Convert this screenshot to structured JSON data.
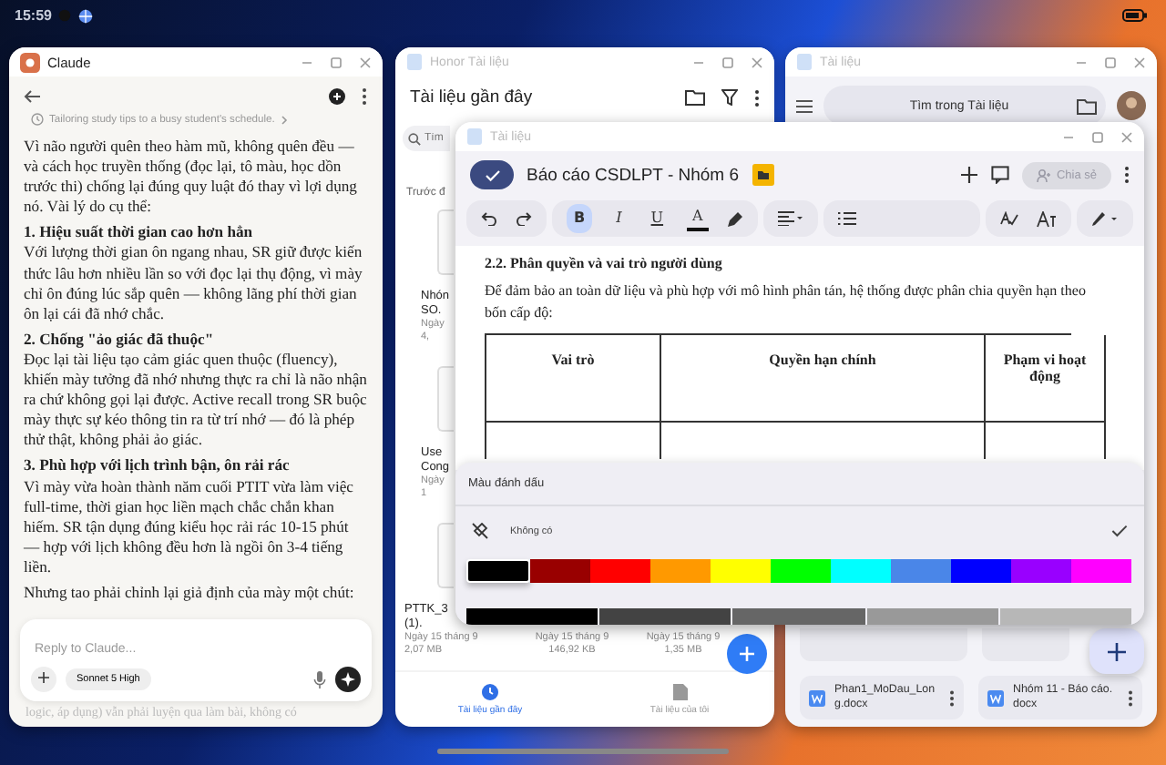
{
  "status_bar": {
    "time": "15:59"
  },
  "claude_window": {
    "title": "Claude",
    "chat_title": "Tailoring study tips to a busy student's schedule.",
    "blocks": [
      {
        "kind": "paragraph",
        "text": "Vì não người quên theo hàm mũ, không quên đều — và cách học truyền thống (đọc lại, tô màu, học dồn trước thi) chống lại đúng quy luật đó thay vì lợi dụng nó. Vài lý do cụ thể:"
      },
      {
        "kind": "heading",
        "text": "1. Hiệu suất thời gian cao hơn hẳn"
      },
      {
        "kind": "paragraph",
        "text": "Với lượng thời gian ôn ngang nhau, SR giữ được kiến thức lâu hơn nhiều lần so với đọc lại thụ động, vì mày chỉ ôn đúng lúc sắp quên — không lãng phí thời gian ôn lại cái đã nhớ chắc."
      },
      {
        "kind": "heading",
        "text": "2. Chống \"ảo giác đã thuộc\""
      },
      {
        "kind": "paragraph",
        "text": "Đọc lại tài liệu tạo cảm giác quen thuộc (fluency), khiến mày tưởng đã nhớ nhưng thực ra chỉ là não nhận ra chứ không gọi lại được. Active recall trong SR buộc mày thực sự kéo thông tin ra từ trí nhớ — đó là phép thử thật, không phải ảo giác."
      },
      {
        "kind": "heading",
        "text": "3. Phù hợp với lịch trình bận, ôn rải rác"
      },
      {
        "kind": "paragraph",
        "text": "Vì mày vừa hoàn thành năm cuối PTIT vừa làm việc full-time, thời gian học liền mạch chắc chắn khan hiếm. SR tận dụng đúng kiểu học rải rác 10-15 phút — hợp với lịch không đều hơn là ngồi ôn 3-4 tiếng liền."
      },
      {
        "kind": "paragraph",
        "text": "Nhưng tao phải chỉnh lại giả định của mày một chút:"
      }
    ],
    "reply": {
      "placeholder": "Reply to Claude...",
      "model": "Sonnet 5 High"
    },
    "tail_line": "logic, áp dụng) vẫn phải luyện qua làm bài, không có"
  },
  "files_window": {
    "title": "Honor Tài liệu",
    "heading": "Tài liệu gần đây",
    "search": {
      "placeholder": "Tìm"
    },
    "section": "Trước đ",
    "partial_files": [
      {
        "name": [
          "Nhón",
          "SO."
        ],
        "date": "Ngày",
        "size": "4,"
      },
      {
        "name": [
          "Use",
          "Cong"
        ],
        "date": "Ngày",
        "size": "1"
      }
    ],
    "bottom_files": [
      {
        "name": [
          "PTTK_3",
          "(1)."
        ],
        "date": "Ngày 15 tháng 9",
        "size": "2,07 MB"
      },
      {
        "date": "Ngày 15 tháng 9",
        "size": "146,92 KB"
      },
      {
        "date": "Ngày 15 tháng 9",
        "size": "1,35 MB"
      }
    ],
    "nav": [
      {
        "label": "Tài liệu gần đây",
        "kind": "recent",
        "selected": true
      },
      {
        "label": "Tài liệu của tôi",
        "kind": "mine",
        "selected": false
      }
    ]
  },
  "docs_window": {
    "title": "Tài liệu",
    "search": {
      "placeholder": "Tìm trong Tài liệu"
    },
    "files": [
      {
        "name": "Phan1_MoDau_Long.docx"
      },
      {
        "name": "Nhóm 11 - Báo cáo.docx"
      }
    ]
  },
  "editor_window": {
    "title": "Tài liệu",
    "doc_title": "Báo cáo CSDLPT - Nhóm 6",
    "share": {
      "label": "Chia sẻ",
      "disabled": true
    },
    "toolbar": [
      [
        {
          "kind": "undo"
        },
        {
          "kind": "redo"
        }
      ],
      [
        {
          "kind": "bold",
          "label": "B",
          "on": true
        },
        {
          "kind": "italic",
          "label": "I",
          "on": false
        },
        {
          "kind": "underline",
          "label": "U",
          "on": false
        },
        {
          "kind": "text_color",
          "label": "A",
          "on": false
        },
        {
          "kind": "highlighter"
        }
      ],
      [
        {
          "kind": "align"
        }
      ],
      [
        {
          "kind": "list"
        }
      ],
      [
        {
          "kind": "spellcheck"
        },
        {
          "kind": "text_format"
        }
      ],
      [
        {
          "kind": "pen"
        }
      ]
    ],
    "heading": "2.2. Phân quyền và vai trò người dùng",
    "paragraph": "Để đảm bảo an toàn dữ liệu và phù hợp với mô hình phân tán, hệ thống được phân chia quyền hạn theo bốn cấp độ:",
    "table": {
      "columns": [
        "Vai trò",
        "Quyền hạn chính",
        "Phạm vi hoạt động"
      ]
    },
    "highlight_panel": {
      "title": "Màu đánh dấu",
      "none_option": {
        "label": "Không có",
        "selected": true
      },
      "colors": [
        {
          "color": "#000000",
          "selected": true
        },
        {
          "color": "#990000",
          "selected": false
        },
        {
          "color": "#ff0000",
          "selected": false
        },
        {
          "color": "#ff9900",
          "selected": false
        },
        {
          "color": "#ffff00",
          "selected": false
        },
        {
          "color": "#00ff00",
          "selected": false
        },
        {
          "color": "#00ffff",
          "selected": false
        },
        {
          "color": "#4a86e8",
          "selected": false
        },
        {
          "color": "#0000ff",
          "selected": false
        },
        {
          "color": "#9900ff",
          "selected": false
        },
        {
          "color": "#ff00ff",
          "selected": false
        }
      ],
      "grays": [
        {
          "color": "#000000"
        },
        {
          "color": "#434343"
        },
        {
          "color": "#666666"
        },
        {
          "color": "#999999"
        },
        {
          "color": "#b7b7b7"
        }
      ]
    }
  }
}
